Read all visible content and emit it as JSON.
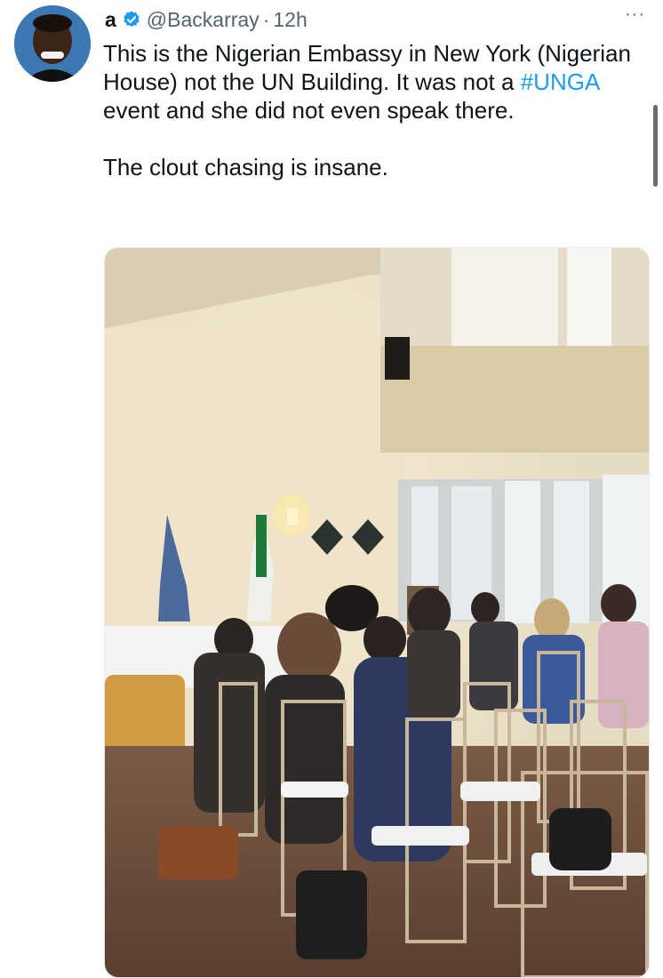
{
  "tweet": {
    "display_name": "a",
    "handle": "@Backarray",
    "separator": "·",
    "timestamp": "12h",
    "more_label": "···",
    "text_line1": "This is the Nigerian Embassy in New York (Nigerian House) not the UN Building. It was not a ",
    "hashtag": "#UNGA",
    "text_line1_end": " event and she did not even speak there.",
    "text_para2": "The clout chasing is insane."
  },
  "colors": {
    "link": "#1d9bf0",
    "verified": "#1d9bf0",
    "secondary_text": "#536471"
  },
  "icons": {
    "verified": "verified-badge-icon",
    "more": "more-options-icon"
  }
}
